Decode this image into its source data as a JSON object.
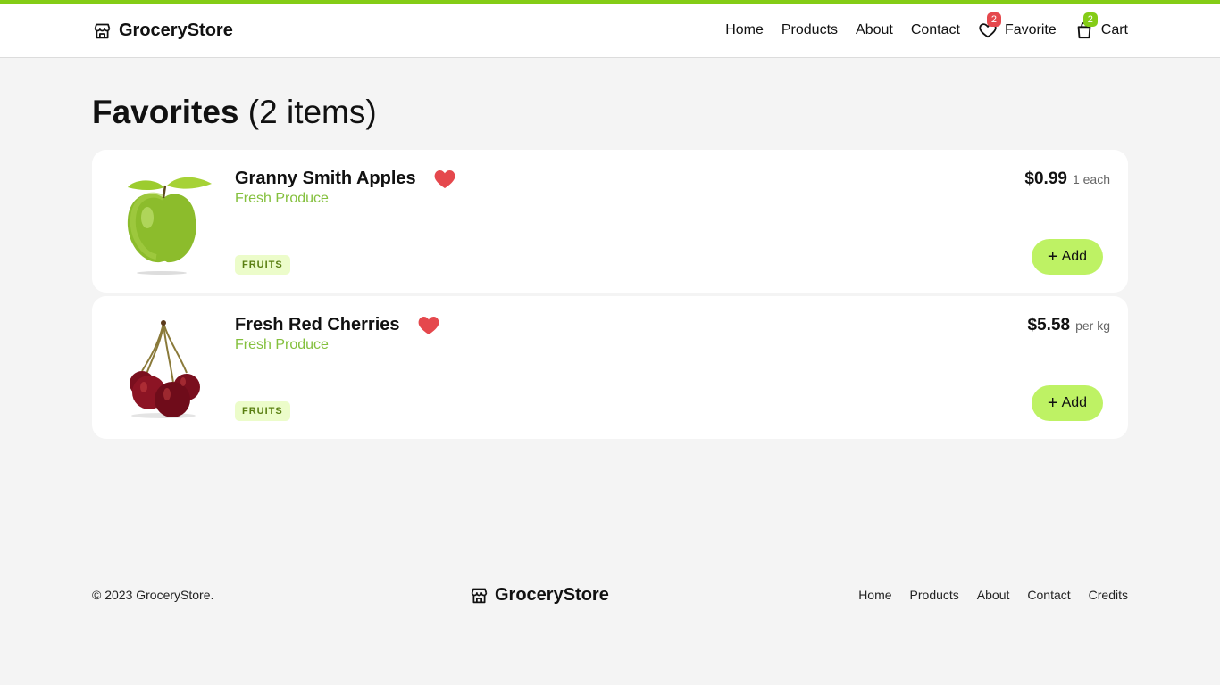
{
  "brand": {
    "name": "GroceryStore",
    "icon": "store-icon"
  },
  "nav": {
    "links": [
      "Home",
      "Products",
      "About",
      "Contact"
    ],
    "favorite": {
      "label": "Favorite",
      "count": "2",
      "icon": "heart-outline-icon"
    },
    "cart": {
      "label": "Cart",
      "count": "2",
      "icon": "shopping-bag-icon"
    }
  },
  "page": {
    "title": "Favorites",
    "count_label": "(2 items)"
  },
  "favorites": [
    {
      "name": "Granny Smith Apples",
      "category": "Fresh Produce",
      "tag": "FRUITS",
      "price": "$0.99",
      "unit": "1 each",
      "add_label": "Add",
      "image": "green-apple"
    },
    {
      "name": "Fresh Red Cherries",
      "category": "Fresh Produce",
      "tag": "FRUITS",
      "price": "$5.58",
      "unit": "per kg",
      "add_label": "Add",
      "image": "red-cherries"
    }
  ],
  "footer": {
    "copyright": "© 2023 GroceryStore.",
    "brand": "GroceryStore",
    "links": [
      "Home",
      "Products",
      "About",
      "Contact",
      "Credits"
    ]
  },
  "colors": {
    "accent": "#84cc16",
    "add_button": "#bef264",
    "category_text": "#84c03d",
    "heart": "#e5484d",
    "tag_bg": "#ecfcca"
  }
}
